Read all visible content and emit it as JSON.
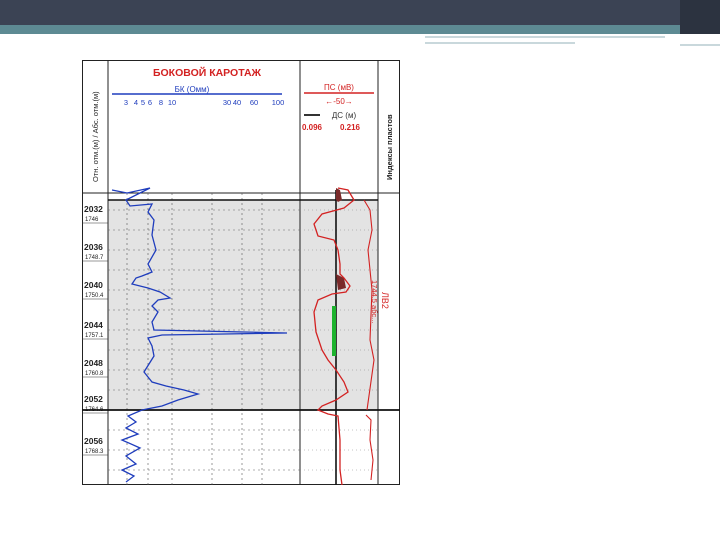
{
  "slide": {
    "colors": {
      "top_band": "#3b4354",
      "teal_band": "#5d8a93",
      "log_blue": "#1f3dbd",
      "log_red": "#d32222"
    }
  },
  "log": {
    "title": "БОКОВОЙ КАРОТАЖ",
    "left_header": "Отн. отм.(м) / Абс. отм.(м)",
    "bk_header": "БК (Омм)",
    "bk_scale": [
      "3",
      "4",
      "5",
      "6",
      "8",
      "10",
      "30",
      "40",
      "60",
      "100"
    ],
    "ps_header": "ПС (мВ)",
    "ps_scale": "←-50→",
    "ds_header": "ДС (м)",
    "ds_scale_min": "0.096",
    "ds_scale_max": "0.216",
    "layer_index_header": "Индексы пластов",
    "layer_label": "ЛВ2",
    "layer_label_sub": "1744.5 абс...",
    "depths": [
      {
        "rel": "2032",
        "abs": "1746"
      },
      {
        "rel": "2036",
        "abs": "1748.7"
      },
      {
        "rel": "2040",
        "abs": "1750.4"
      },
      {
        "rel": "2044",
        "abs": "1757.1"
      },
      {
        "rel": "2048",
        "abs": "1760.8"
      },
      {
        "rel": "2052",
        "abs": "1764.6"
      },
      {
        "rel": "2056",
        "abs": "1768.3"
      }
    ]
  }
}
